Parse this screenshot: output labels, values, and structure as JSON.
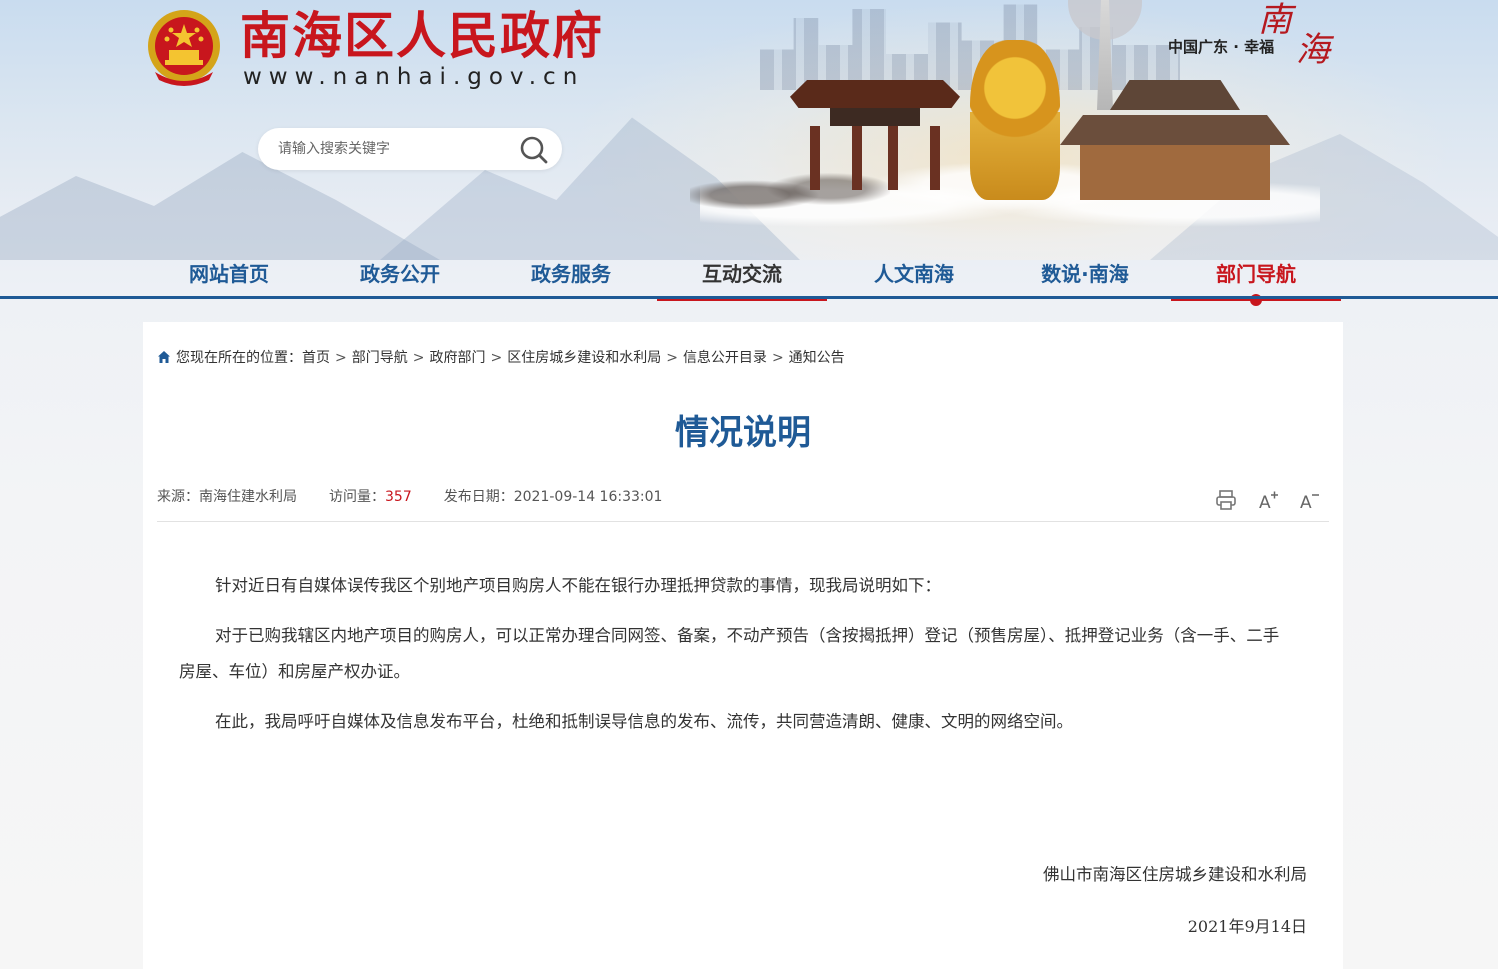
{
  "header": {
    "site_title": "南海区人民政府",
    "site_url": "www.nanhai.gov.cn",
    "slogan": "中国广东 · 幸福",
    "seal": [
      "南",
      "海"
    ],
    "search": {
      "placeholder": "请输入搜索关键字"
    }
  },
  "nav": {
    "items": [
      {
        "label": "网站首页",
        "state": "normal"
      },
      {
        "label": "政务公开",
        "state": "normal"
      },
      {
        "label": "政务服务",
        "state": "normal"
      },
      {
        "label": "互动交流",
        "state": "hover"
      },
      {
        "label": "人文南海",
        "state": "normal"
      },
      {
        "label": "数说·南海",
        "state": "normal"
      },
      {
        "label": "部门导航",
        "state": "active"
      }
    ]
  },
  "breadcrumb": {
    "prefix": "您现在所在的位置：",
    "items": [
      "首页",
      "部门导航",
      "政府部门",
      "区住房城乡建设和水利局",
      "信息公开目录",
      "通知公告"
    ],
    "separator": ">"
  },
  "article": {
    "title": "情况说明",
    "meta": {
      "source_label": "来源：",
      "source": "南海住建水利局",
      "views_label": "访问量：",
      "views": "357",
      "date_label": "发布日期：",
      "date": "2021-09-14 16:33:01"
    },
    "paragraphs": [
      "针对近日有自媒体误传我区个别地产项目购房人不能在银行办理抵押贷款的事情，现我局说明如下：",
      "对于已购我辖区内地产项目的购房人，可以正常办理合同网签、备案，不动产预告（含按揭抵押）登记（预售房屋）、抵押登记业务（含一手、二手房屋、车位）和房屋产权办证。",
      "在此，我局呼吁自媒体及信息发布平台，杜绝和抵制误导信息的发布、流传，共同营造清朗、健康、文明的网络空间。"
    ],
    "signature": "佛山市南海区住房城乡建设和水利局",
    "sign_date": "2021年9月14日"
  },
  "tools": {
    "print": "print-icon",
    "font_larger": "font-increase-icon",
    "font_smaller": "font-decrease-icon"
  },
  "colors": {
    "brand_red": "#c8161d",
    "nav_blue": "#1f5a96"
  }
}
